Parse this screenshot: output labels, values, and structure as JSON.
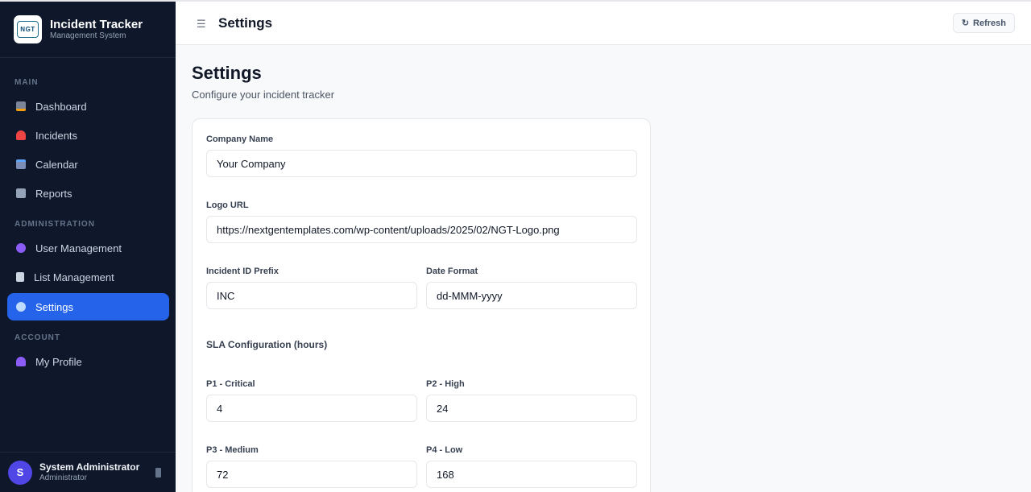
{
  "brand": {
    "logo_text": "NGT",
    "title": "Incident Tracker",
    "subtitle": "Management System"
  },
  "sidebar": {
    "sections": {
      "main": "MAIN",
      "administration": "ADMINISTRATION",
      "account": "ACCOUNT"
    },
    "items": [
      {
        "label": "Dashboard",
        "icon": "bar-chart-icon",
        "color": "#a3a3a3"
      },
      {
        "label": "Incidents",
        "icon": "siren-icon",
        "color": "#ef4444"
      },
      {
        "label": "Calendar",
        "icon": "calendar-icon",
        "color": "#7c8db5"
      },
      {
        "label": "Reports",
        "icon": "line-chart-icon",
        "color": "#94a3b8"
      },
      {
        "label": "User Management",
        "icon": "users-icon",
        "color": "#8b5cf6"
      },
      {
        "label": "List Management",
        "icon": "document-icon",
        "color": "#cbd5e1"
      },
      {
        "label": "Settings",
        "icon": "gear-icon",
        "color": "#93c5fd",
        "active": true
      },
      {
        "label": "My Profile",
        "icon": "user-icon",
        "color": "#8b5cf6"
      }
    ],
    "user": {
      "initial": "S",
      "name": "System Administrator",
      "role": "Administrator"
    }
  },
  "topbar": {
    "title": "Settings",
    "refresh_label": "Refresh"
  },
  "main": {
    "title": "Settings",
    "subtitle": "Configure your incident tracker",
    "form": {
      "company_name_label": "Company Name",
      "company_name_value": "Your Company",
      "logo_url_label": "Logo URL",
      "logo_url_value": "https://nextgentemplates.com/wp-content/uploads/2025/02/NGT-Logo.png",
      "prefix_label": "Incident ID Prefix",
      "prefix_value": "INC",
      "date_format_label": "Date Format",
      "date_format_value": "dd-MMM-yyyy",
      "sla_heading": "SLA Configuration (hours)",
      "p1_label": "P1 - Critical",
      "p1_value": "4",
      "p2_label": "P2 - High",
      "p2_value": "24",
      "p3_label": "P3 - Medium",
      "p3_value": "72",
      "p4_label": "P4 - Low",
      "p4_value": "168"
    }
  },
  "colors": {
    "sidebar_bg": "#0f172a",
    "accent": "#2563eb",
    "avatar": "#4f46e5"
  }
}
